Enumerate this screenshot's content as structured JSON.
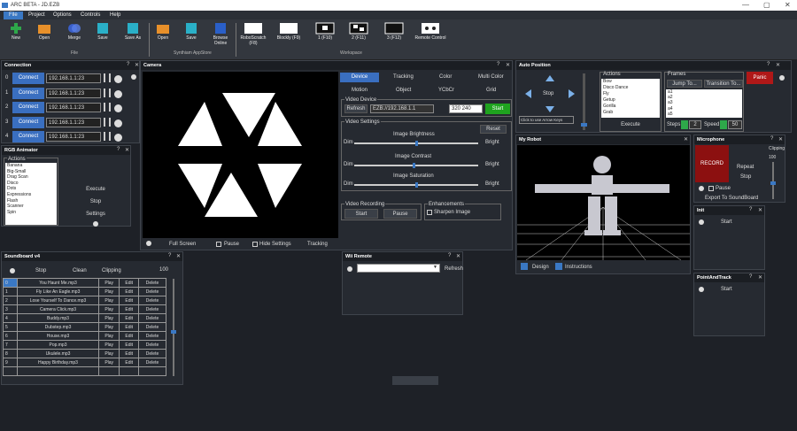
{
  "app": {
    "title": "ARC BETA - JD.EZB"
  },
  "menu": [
    "File",
    "Project",
    "Options",
    "Controls",
    "Help"
  ],
  "ribbon": {
    "file_buttons": [
      "New",
      "Open",
      "Merge",
      "Save",
      "Save As"
    ],
    "file_group": "File",
    "store_buttons": [
      "Open",
      "Save",
      "Browse Online"
    ],
    "store_group": "Synthiam AppStore",
    "workspace_buttons": [
      "RoboScratch (F8)",
      "Blockly (F9)",
      "1 (F10)",
      "2 (F11)",
      "3 (F12)",
      "Remote Control"
    ],
    "workspace_group": "Workspace"
  },
  "connection": {
    "title": "Connection",
    "rows": [
      {
        "idx": "0",
        "button": "Connect",
        "addr": "192.168.1.1:23"
      },
      {
        "idx": "1",
        "button": "Connect",
        "addr": "192.168.1.1:23"
      },
      {
        "idx": "2",
        "button": "Connect",
        "addr": "192.168.1.1:23"
      },
      {
        "idx": "3",
        "button": "Connect",
        "addr": "192.168.1.1:23"
      },
      {
        "idx": "4",
        "button": "Connect",
        "addr": "192.168.1.1:23"
      }
    ]
  },
  "rgb": {
    "title": "RGB Animator",
    "actions_label": "Actions",
    "items": [
      "Banana",
      "Big-Small",
      "Drag Scan",
      "Disco",
      "Dots",
      "Expressions",
      "Flash",
      "Scanner",
      "Spin"
    ],
    "buttons": [
      "Execute",
      "Stop",
      "Settings"
    ]
  },
  "camera": {
    "title": "Camera",
    "tabs_row1": [
      "Device",
      "Tracking",
      "Color",
      "Multi Color"
    ],
    "tabs_row2": [
      "Motion",
      "Object",
      "YCbCr",
      "Grid"
    ],
    "video_device_label": "Video Device",
    "refresh": "Refresh",
    "device_value": "EZB://192.168.1.1",
    "resolution": "320 240",
    "start": "Start",
    "video_settings_label": "Video Settings",
    "reset": "Reset",
    "brightness_label": "Image Brightness",
    "contrast_label": "Image Contrast",
    "saturation_label": "Image Saturation",
    "dim": "Dim",
    "bright": "Bright",
    "brightness": 0.5,
    "contrast": 0.48,
    "saturation": 0.5,
    "recording_label": "Video Recording",
    "rec_start": "Start",
    "rec_pause": "Pause",
    "enhancements_label": "Enhancements",
    "sharpen": "Sharpen Image",
    "bottom": {
      "fullscreen": "Full Screen",
      "pause": "Pause",
      "hide": "Hide Settings",
      "tracking": "Tracking"
    }
  },
  "autopos": {
    "title": "Auto Position",
    "stop": "Stop",
    "hint": "Click to use Arrow Keys",
    "actions_label": "Actions",
    "actions": [
      "Bow",
      "Disco Dance",
      "Fly",
      "Getup",
      "Gorilla",
      "Grab"
    ],
    "execute": "Execute",
    "frames_label": "Frames",
    "jump": "Jump To...",
    "transition": "Transition To...",
    "frames": [
      "a1",
      "a2",
      "a3",
      "a4",
      "a5"
    ],
    "panic": "Panic",
    "steps_label": "Steps",
    "steps": "2",
    "speed_label": "Speed",
    "speed": "50"
  },
  "myrobot": {
    "title": "My Robot",
    "design": "Design",
    "instructions": "Instructions"
  },
  "microphone": {
    "title": "Microphone",
    "record": "RECORD",
    "repeat": "Repeat",
    "stop": "Stop",
    "pause": "Pause",
    "clipping": "Clipping",
    "level": "100",
    "export": "Export To SoundBoard"
  },
  "init": {
    "title": "Init",
    "start": "Start"
  },
  "pointtrack": {
    "title": "PointAndTrack",
    "start": "Start"
  },
  "soundboard": {
    "title": "Soundboard v4",
    "stop": "Stop",
    "clean": "Clean",
    "clipping": "Clipping",
    "level": "100",
    "rows": [
      {
        "idx": "0",
        "file": "You Haunt Me.mp3"
      },
      {
        "idx": "1",
        "file": "Fly Like An Eagle.mp3"
      },
      {
        "idx": "2",
        "file": "Lose Yourself To Dance.mp3"
      },
      {
        "idx": "3",
        "file": "Camera Click.mp3"
      },
      {
        "idx": "4",
        "file": "Buddy.mp3"
      },
      {
        "idx": "5",
        "file": "Dubstep.mp3"
      },
      {
        "idx": "6",
        "file": "House.mp3"
      },
      {
        "idx": "7",
        "file": "Pop.mp3"
      },
      {
        "idx": "8",
        "file": "Ukulele.mp3"
      },
      {
        "idx": "9",
        "file": "Happy Birthday.mp3"
      }
    ],
    "play": "Play",
    "edit": "Edit",
    "delete": "Delete"
  },
  "wii": {
    "title": "Wii Remote",
    "refresh": "Refresh"
  }
}
